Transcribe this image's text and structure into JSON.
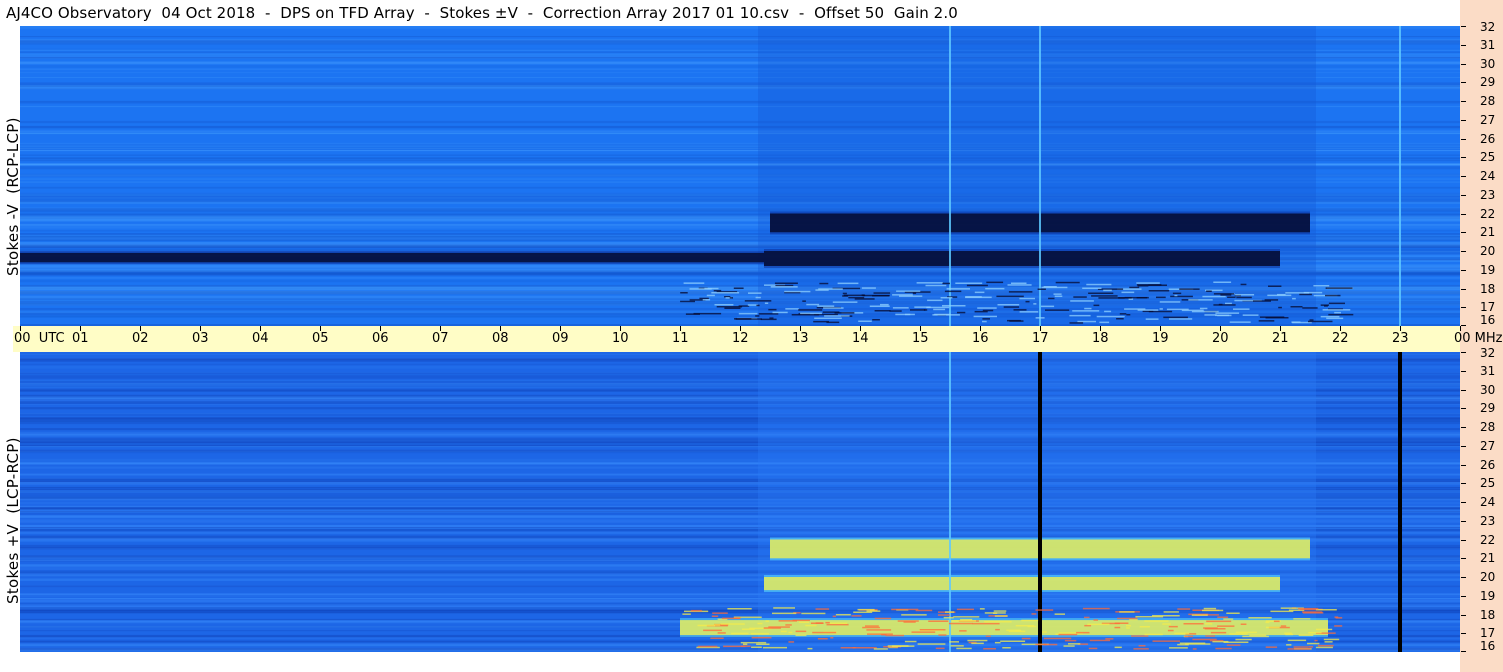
{
  "title": "AJ4CO Observatory  04 Oct 2018  -  DPS on TFD Array  -  Stokes ±V  -  Correction Array 2017 01 10.csv  -  Offset 50  Gain 2.0",
  "panels": [
    {
      "id": "top",
      "ylabel": "Stokes -V  (RCP-LCP)",
      "mode": "dark"
    },
    {
      "id": "bottom",
      "ylabel": "Stokes +V  (LCP-RCP)",
      "mode": "bright"
    }
  ],
  "time_axis": {
    "labels": [
      "00  UTC",
      "01",
      "02",
      "03",
      "04",
      "05",
      "06",
      "07",
      "08",
      "09",
      "10",
      "11",
      "12",
      "13",
      "14",
      "15",
      "16",
      "17",
      "18",
      "19",
      "20",
      "21",
      "22",
      "23",
      "00 MHz"
    ]
  },
  "freq_axis": {
    "labels": [
      "32",
      "31",
      "30",
      "29",
      "28",
      "27",
      "26",
      "25",
      "24",
      "23",
      "22",
      "21",
      "20",
      "19",
      "18",
      "17",
      "16"
    ]
  },
  "colors": {
    "background": "#1a6ff0",
    "accent_dark": "#050a30",
    "accent_bright": "#f0f050",
    "axis_bg": "#fffdc6",
    "strip_bg": "#fbdcc6"
  },
  "chart_data": {
    "type": "heatmap",
    "title": "AJ4CO Observatory  04 Oct 2018  -  DPS on TFD Array  -  Stokes ±V  -  Correction Array 2017 01 10.csv  -  Offset 50  Gain 2.0",
    "x_unit": "UTC",
    "x_range": [
      0,
      24
    ],
    "y_unit": "MHz",
    "y_range": [
      16,
      32
    ],
    "series": [
      {
        "name": "Stokes -V  (RCP-LCP)",
        "features": [
          {
            "kind": "dark_band",
            "x": [
              12.4,
              21.0
            ],
            "y": [
              19.2,
              20.0
            ]
          },
          {
            "kind": "dark_band",
            "x": [
              12.5,
              21.5
            ],
            "y": [
              21.0,
              22.0
            ]
          },
          {
            "kind": "dark_band",
            "x": [
              0.0,
              12.4
            ],
            "y": [
              19.4,
              19.9
            ]
          },
          {
            "kind": "vertical_line",
            "x": 17.0
          },
          {
            "kind": "vertical_line",
            "x": 23.0
          },
          {
            "kind": "vertical_line",
            "x": 15.5
          }
        ]
      },
      {
        "name": "Stokes +V  (LCP-RCP)",
        "features": [
          {
            "kind": "bright_band",
            "x": [
              12.4,
              21.0
            ],
            "y": [
              19.3,
              20.0
            ]
          },
          {
            "kind": "bright_band",
            "x": [
              12.5,
              21.5
            ],
            "y": [
              21.0,
              22.0
            ]
          },
          {
            "kind": "bright_band",
            "x": [
              11.0,
              21.8
            ],
            "y": [
              16.9,
              17.7
            ]
          },
          {
            "kind": "vertical_line",
            "x": 17.0
          },
          {
            "kind": "vertical_line",
            "x": 23.0
          },
          {
            "kind": "vertical_line",
            "x": 15.5
          }
        ]
      }
    ]
  }
}
